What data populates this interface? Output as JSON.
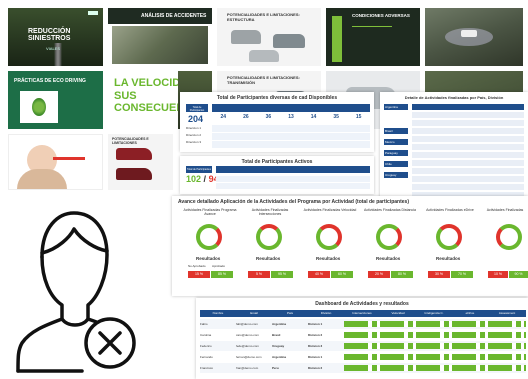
{
  "slides": {
    "s1": {
      "title_line1": "REDUCCIÓN",
      "title_line2": "SINIESTROS",
      "subtitle": "VIALES"
    },
    "s2": {
      "title": "ANÁLISIS DE ACCIDENTES"
    },
    "s3": {
      "title": "POTENCIALIDADES E LIMITACIONES: ESTRUCTURA"
    },
    "s4": {
      "title": "CONDICIONES ADVERSAS"
    },
    "s6": {
      "title_line1": "PRÁCTICAS DE ECO DRIVING"
    },
    "s7": {
      "title_line1": "LA VELOCIDAD Y",
      "title_line2": "SUS CONSECUENCIAS"
    },
    "s8": {
      "title": "POTENCIALIDADES E LIMITACIONES: TRANSMISIÓN"
    },
    "s11": {
      "title": "POTENCIALIDADES E LIMITACIONES"
    }
  },
  "report1": {
    "title": "Total de Participantes diversas de cad Disponibles",
    "total": "204",
    "sub_header": "Total de Participantes",
    "col_values": [
      "24",
      "26",
      "36",
      "13",
      "14",
      "35",
      "15"
    ],
    "rows": [
      "Direccion 1",
      "Direccion 2",
      "Direccion 3"
    ]
  },
  "report2": {
    "title": "Detalle de Actividades finalizadas por País, División",
    "countries": [
      "Argentina",
      "Brasil",
      "Mexico",
      "Paraguay",
      "Chile",
      "Uruguay"
    ]
  },
  "report3": {
    "title": "Total de Participantes Activos",
    "active": "102",
    "total": "94",
    "header_label": "Total de Participantes"
  },
  "progress": {
    "title": "Avance detallado Aplicación de la Actividades del Programa por Actividad (total de participantes)",
    "cards": [
      {
        "label": "Actividades Finalizadas Programa Avance"
      },
      {
        "label": "Actividades Finalizadas Intersecciones"
      },
      {
        "label": "Actividades Finalizadas Velocidad"
      },
      {
        "label": "Actividades Finalizadas Distancia"
      },
      {
        "label": "Actividades Finalizadas eDrive"
      },
      {
        "label": "Actividades Finalizadas"
      }
    ],
    "results_label": "Resultados",
    "no_aprobado": "No Aprobado",
    "aprobado": "Aprobado",
    "red_pct": [
      "15 %",
      "5 %",
      "40 %",
      "20 %",
      "30 %",
      "10 %"
    ],
    "green_pct": [
      "85 %",
      "95 %",
      "60 %",
      "80 %",
      "70 %",
      "90 %"
    ]
  },
  "dashboard": {
    "title": "Dashboard de Actividades y resultados",
    "columns": [
      "Nombre",
      "Email",
      "País",
      "División",
      "Intersecciones",
      "Velocidad",
      "Inteligencia C.",
      "eDrive",
      "Assessment"
    ],
    "rows": [
      {
        "name": "Fabio",
        "email": "fabi@demo.com",
        "country": "Argentina",
        "division": "Division 1"
      },
      {
        "name": "Carolina",
        "email": "caro@demo.com",
        "country": "Brasil",
        "division": "Division 2"
      },
      {
        "name": "Federico",
        "email": "fede@demo.com",
        "country": "Uruguay",
        "division": "Division 3"
      },
      {
        "name": "Fernando",
        "email": "fernan@demo.com",
        "country": "Argentina",
        "division": "Division 1"
      },
      {
        "name": "Francisco",
        "email": "fran@demo.com",
        "country": "Peru",
        "division": "Division 2"
      }
    ]
  },
  "colors": {
    "green": "#6ab72e",
    "red": "#e0342c",
    "navy": "#1f4e8c",
    "dark_slide": "#1d2a22"
  }
}
